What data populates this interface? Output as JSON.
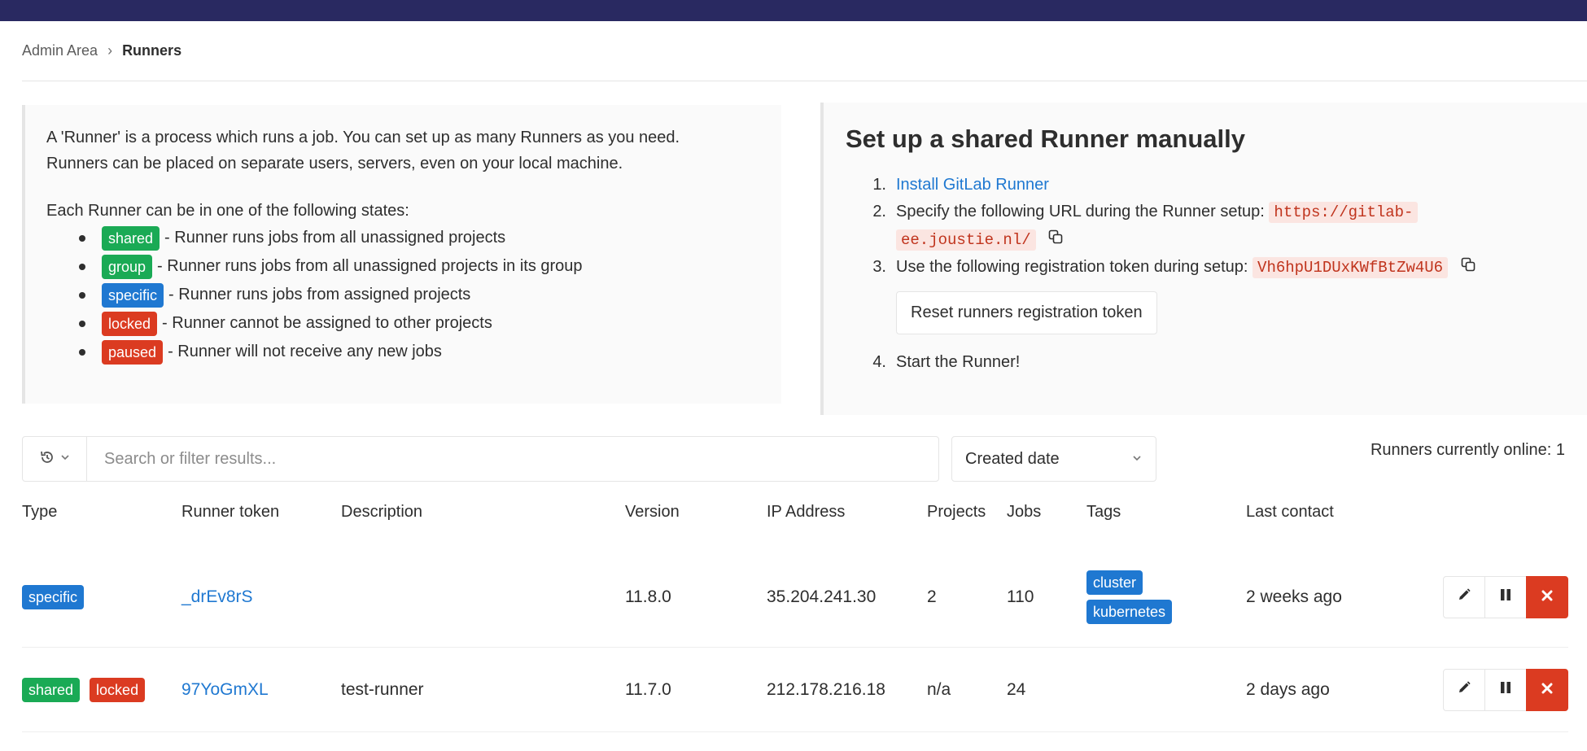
{
  "breadcrumb": {
    "parent": "Admin Area",
    "current": "Runners"
  },
  "intro": {
    "line1": "A 'Runner' is a process which runs a job. You can set up as many Runners as you need.",
    "line2": "Runners can be placed on separate users, servers, even on your local machine.",
    "states_intro": "Each Runner can be in one of the following states:",
    "states": [
      {
        "badge": "shared",
        "color": "#1aaa55",
        "text": "- Runner runs jobs from all unassigned projects"
      },
      {
        "badge": "group",
        "color": "#1aaa55",
        "text": "- Runner runs jobs from all unassigned projects in its group"
      },
      {
        "badge": "specific",
        "color": "#1f78d1",
        "text": "- Runner runs jobs from assigned projects"
      },
      {
        "badge": "locked",
        "color": "#db3b21",
        "text": "- Runner cannot be assigned to other projects"
      },
      {
        "badge": "paused",
        "color": "#db3b21",
        "text": "- Runner will not receive any new jobs"
      }
    ]
  },
  "setup": {
    "title": "Set up a shared Runner manually",
    "step1_num": "1.",
    "step1_link": "Install GitLab Runner",
    "step2_num": "2.",
    "step2_text": "Specify the following URL during the Runner setup:",
    "step2_url_part1": "https://gitlab-",
    "step2_url_part2": "ee.joustie.nl/",
    "step3_num": "3.",
    "step3_text": "Use the following registration token during setup:",
    "step3_token": "Vh6hpU1DUxKWfBtZw4U6",
    "reset_button": "Reset runners registration token",
    "step4_num": "4.",
    "step4_text": "Start the Runner!"
  },
  "filter": {
    "search_placeholder": "Search or filter results...",
    "sort_value": "Created date",
    "online_count": "Runners currently online: 1"
  },
  "table": {
    "headers": [
      "Type",
      "Runner token",
      "Description",
      "Version",
      "IP Address",
      "Projects",
      "Jobs",
      "Tags",
      "Last contact"
    ],
    "rows": [
      {
        "type_badges": [
          "specific"
        ],
        "token": "_drEv8rS",
        "description": "",
        "version": "11.8.0",
        "ip": "35.204.241.30",
        "projects": "2",
        "jobs": "110",
        "tags": [
          "cluster",
          "kubernetes"
        ],
        "last_contact": "2 weeks ago"
      },
      {
        "type_badges": [
          "shared",
          "locked"
        ],
        "token": "97YoGmXL",
        "description": "test-runner",
        "version": "11.7.0",
        "ip": "212.178.216.18",
        "projects": "n/a",
        "jobs": "24",
        "tags": [],
        "last_contact": "2 days ago"
      }
    ]
  },
  "colors": {
    "topbar": "#292961",
    "green": "#1aaa55",
    "blue": "#1f78d1",
    "orange": "#db3b21"
  },
  "icons": [
    "history-icon",
    "chevron-down-icon",
    "copy-icon",
    "pencil-icon",
    "pause-icon",
    "close-icon"
  ]
}
